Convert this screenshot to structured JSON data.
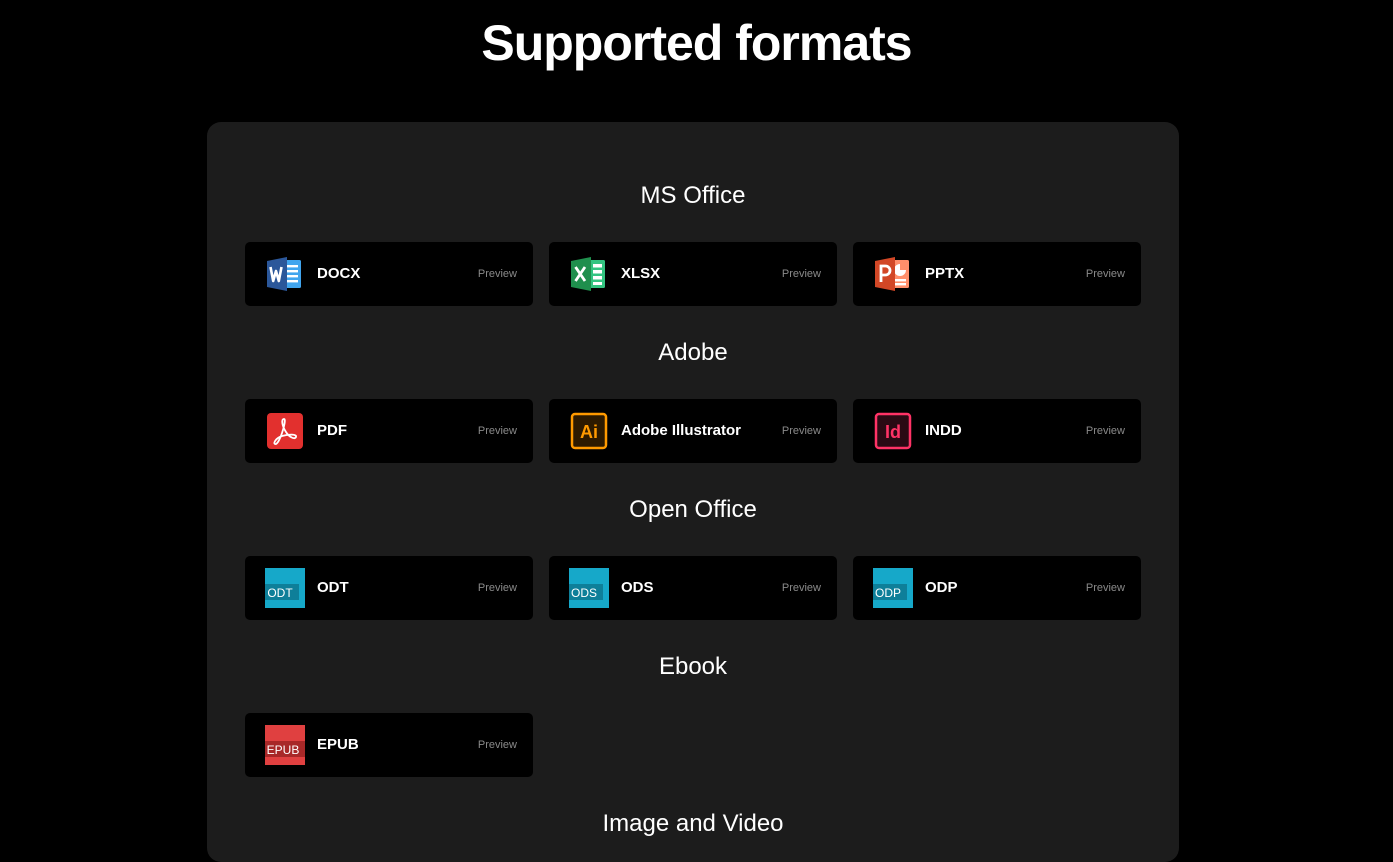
{
  "page": {
    "title": "Supported formats"
  },
  "colors": {
    "panel_bg": "#1c1c1c",
    "card_bg": "#000000",
    "word_blue": "#2b579a",
    "excel_green": "#1f8f4d",
    "ppt_orange": "#d24726",
    "pdf_red": "#e2302e",
    "ai_orange": "#ff9a00",
    "indd_pink": "#ff3366",
    "odf_cyan": "#16a8c9",
    "epub_red": "#e04040"
  },
  "sections": [
    {
      "title": "MS Office",
      "items": [
        {
          "name": "DOCX",
          "preview": "Preview",
          "icon": "word-icon"
        },
        {
          "name": "XLSX",
          "preview": "Preview",
          "icon": "excel-icon"
        },
        {
          "name": "PPTX",
          "preview": "Preview",
          "icon": "powerpoint-icon"
        }
      ]
    },
    {
      "title": "Adobe",
      "items": [
        {
          "name": "PDF",
          "preview": "Preview",
          "icon": "acrobat-icon"
        },
        {
          "name": "Adobe Illustrator",
          "preview": "Preview",
          "icon": "illustrator-icon",
          "icon_text": "Ai"
        },
        {
          "name": "INDD",
          "preview": "Preview",
          "icon": "indesign-icon",
          "icon_text": "Id"
        }
      ]
    },
    {
      "title": "Open Office",
      "items": [
        {
          "name": "ODT",
          "preview": "Preview",
          "icon": "odt-icon",
          "icon_text": "ODT"
        },
        {
          "name": "ODS",
          "preview": "Preview",
          "icon": "ods-icon",
          "icon_text": "ODS"
        },
        {
          "name": "ODP",
          "preview": "Preview",
          "icon": "odp-icon",
          "icon_text": "ODP"
        }
      ]
    },
    {
      "title": "Ebook",
      "items": [
        {
          "name": "EPUB",
          "preview": "Preview",
          "icon": "epub-icon",
          "icon_text": "EPUB"
        }
      ]
    },
    {
      "title": "Image and Video",
      "items": []
    }
  ]
}
